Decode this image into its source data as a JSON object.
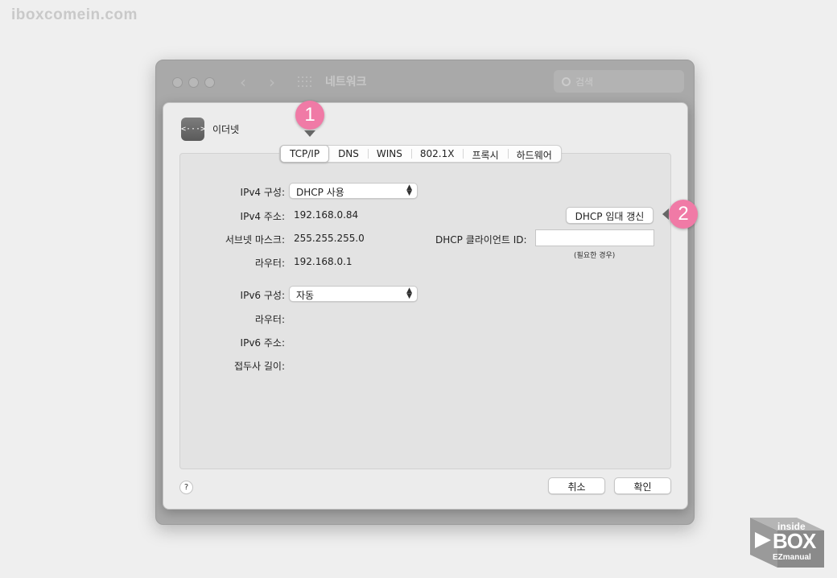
{
  "watermark": "iboxcomein.com",
  "window": {
    "title": "네트워크",
    "search_placeholder": "검색"
  },
  "sheet": {
    "interface_name": "이더넷",
    "interface_icon": "<···>",
    "tabs": [
      "TCP/IP",
      "DNS",
      "WINS",
      "802.1X",
      "프록시",
      "하드웨어"
    ],
    "active_tab": "TCP/IP",
    "ipv4": {
      "config_label": "IPv4 구성:",
      "config_value": "DHCP 사용",
      "address_label": "IPv4 주소:",
      "address_value": "192.168.0.84",
      "subnet_label": "서브넷 마스크:",
      "subnet_value": "255.255.255.0",
      "router_label": "라우터:",
      "router_value": "192.168.0.1"
    },
    "dhcp": {
      "renew_button": "DHCP 임대 갱신",
      "client_id_label": "DHCP 클라이언트 ID:",
      "client_id_value": "",
      "client_id_hint": "(필요한 경우)"
    },
    "ipv6": {
      "config_label": "IPv6 구성:",
      "config_value": "자동",
      "router_label": "라우터:",
      "address_label": "IPv6 주소:",
      "prefix_label": "접두사 길이:"
    },
    "help_label": "?",
    "cancel_button": "취소",
    "ok_button": "확인"
  },
  "annotations": {
    "badge1": "1",
    "badge2": "2"
  },
  "logo": {
    "line1": "inside",
    "line2": "BOX",
    "line3": "EZmanual"
  },
  "colors": {
    "badge": "#f07aa6",
    "background": "#efefef"
  }
}
